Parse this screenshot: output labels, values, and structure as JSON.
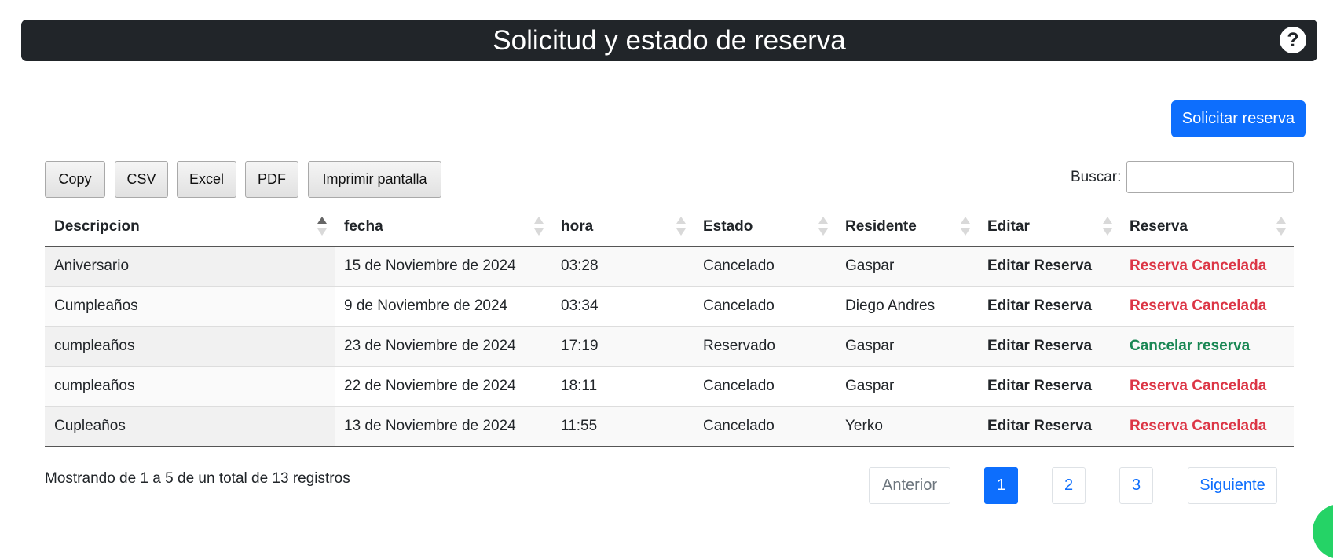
{
  "header": {
    "title": "Solicitud y estado de reserva",
    "help_label": "?"
  },
  "actions": {
    "request_label": "Solicitar reserva"
  },
  "export_buttons": [
    "Copy",
    "CSV",
    "Excel",
    "PDF",
    "Imprimir pantalla"
  ],
  "search": {
    "label": "Buscar:",
    "value": ""
  },
  "table": {
    "columns": [
      "Descripcion",
      "fecha",
      "hora",
      "Estado",
      "Residente",
      "Editar",
      "Reserva"
    ],
    "sorted_column": "Descripcion",
    "rows": [
      {
        "descripcion": "Aniversario",
        "fecha": "15 de Noviembre de 2024",
        "hora": "03:28",
        "estado": "Cancelado",
        "residente": "Gaspar",
        "editar": "Editar Reserva",
        "reserva": "Reserva Cancelada",
        "reserva_status": "cancelled"
      },
      {
        "descripcion": "Cumpleaños",
        "fecha": "9 de Noviembre de 2024",
        "hora": "03:34",
        "estado": "Cancelado",
        "residente": "Diego Andres",
        "editar": "Editar Reserva",
        "reserva": "Reserva Cancelada",
        "reserva_status": "cancelled"
      },
      {
        "descripcion": "cumpleaños",
        "fecha": "23 de Noviembre de 2024",
        "hora": "17:19",
        "estado": "Reservado",
        "residente": "Gaspar",
        "editar": "Editar Reserva",
        "reserva": "Cancelar reserva",
        "reserva_status": "active"
      },
      {
        "descripcion": "cumpleaños",
        "fecha": "22 de Noviembre de 2024",
        "hora": "18:11",
        "estado": "Cancelado",
        "residente": "Gaspar",
        "editar": "Editar Reserva",
        "reserva": "Reserva Cancelada",
        "reserva_status": "cancelled"
      },
      {
        "descripcion": "Cupleaños",
        "fecha": "13 de Noviembre de 2024",
        "hora": "11:55",
        "estado": "Cancelado",
        "residente": "Yerko",
        "editar": "Editar Reserva",
        "reserva": "Reserva Cancelada",
        "reserva_status": "cancelled"
      }
    ]
  },
  "footer": {
    "info": "Mostrando de 1 a 5 de un total de 13 registros",
    "pagination": {
      "prev": "Anterior",
      "pages": [
        "1",
        "2",
        "3"
      ],
      "current": "1",
      "next": "Siguiente"
    }
  },
  "colors": {
    "header_bg": "#212529",
    "primary": "#0d6efd",
    "danger": "#dc3545",
    "success": "#198754"
  }
}
